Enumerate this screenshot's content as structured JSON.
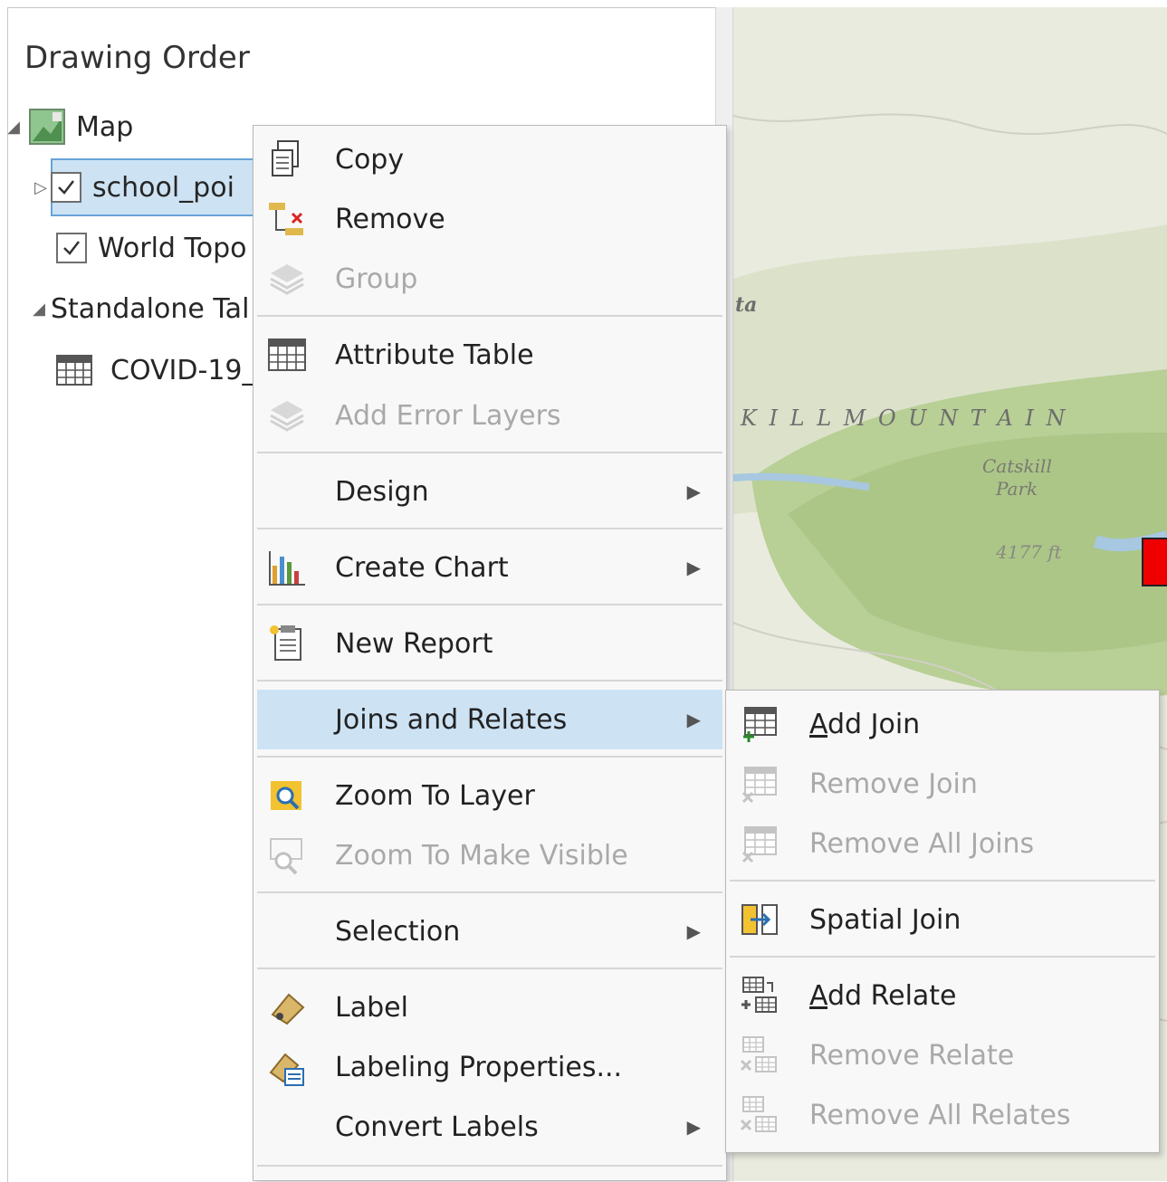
{
  "pane": {
    "title": "Drawing Order",
    "map_label": "Map",
    "layers": [
      "school_poi",
      "World Topo"
    ],
    "standalone_label": "Standalone Tal",
    "table_label": "COVID-19_"
  },
  "map": {
    "labels": [
      "ta",
      "K I L L   M O U N T A I N",
      "Catskill",
      "Park",
      "4177 ft"
    ]
  },
  "context_menu": {
    "items": [
      {
        "label": "Copy"
      },
      {
        "label": "Remove"
      },
      {
        "label": "Group",
        "disabled": true
      },
      {
        "label": "Attribute Table"
      },
      {
        "label": "Add Error Layers",
        "disabled": true
      },
      {
        "label": "Design"
      },
      {
        "label": "Create Chart"
      },
      {
        "label": "New Report"
      },
      {
        "label": "Joins and Relates"
      },
      {
        "label": "Zoom To Layer"
      },
      {
        "label": "Zoom To Make Visible",
        "disabled": true
      },
      {
        "label": "Selection"
      },
      {
        "label": "Label"
      },
      {
        "label": "Labeling Properties..."
      },
      {
        "label": "Convert Labels"
      }
    ]
  },
  "submenu": {
    "items": [
      {
        "access": "A",
        "rest": "dd Join"
      },
      {
        "label": "Remove Join",
        "disabled": true
      },
      {
        "label": "Remove All Joins",
        "disabled": true
      },
      {
        "label": "Spatial Join"
      },
      {
        "access": "A",
        "rest": "dd Relate"
      },
      {
        "label": "Remove Relate",
        "disabled": true
      },
      {
        "label": "Remove All Relates",
        "disabled": true
      }
    ]
  },
  "colors": {
    "hover": "#cde3f4",
    "selection_border": "#66a3d9",
    "disabled_text": "#a9a9a9",
    "marker": "#ee0000"
  }
}
